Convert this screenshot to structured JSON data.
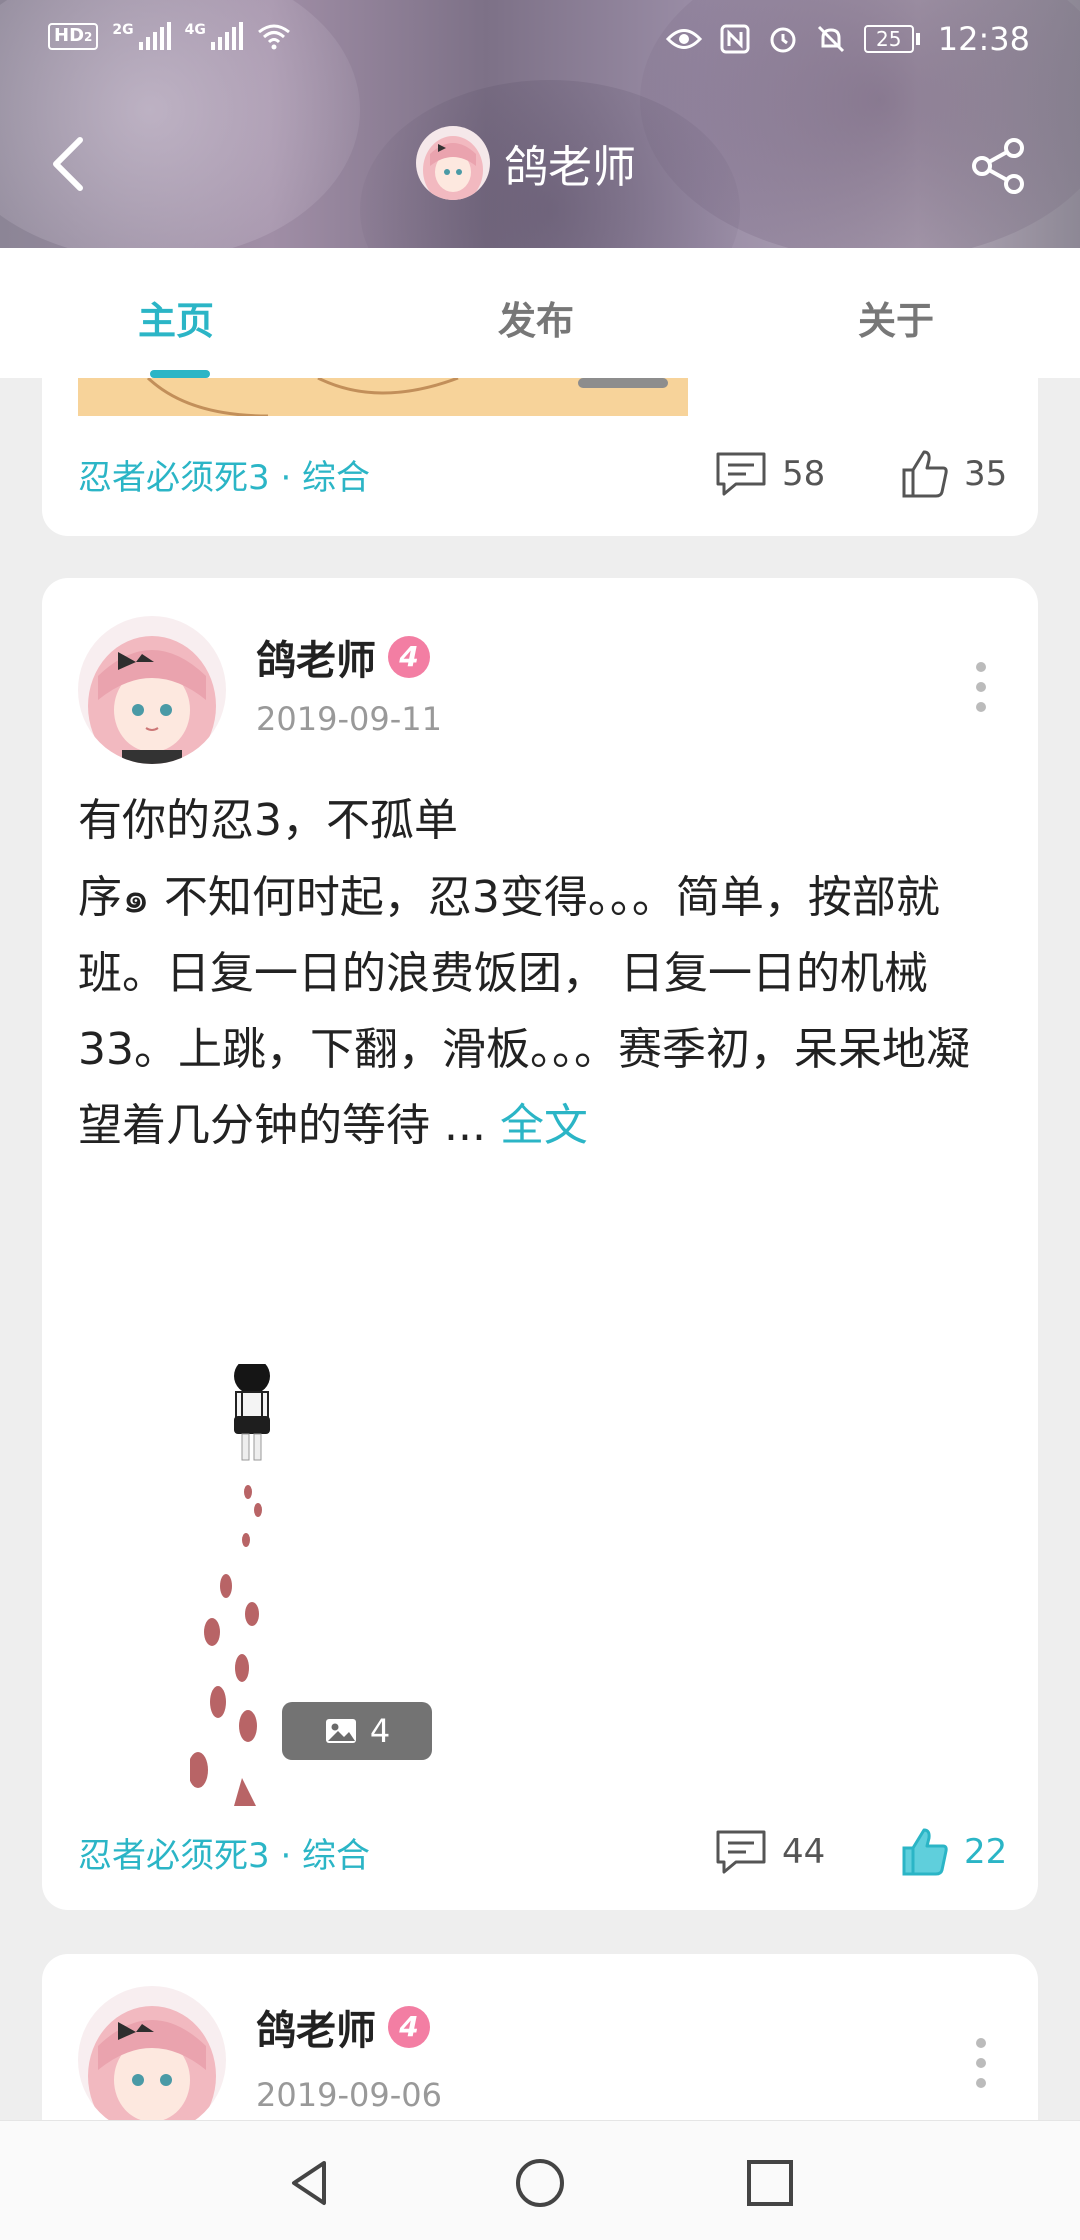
{
  "status_bar": {
    "hd_label": "HD",
    "hd_sub": "2",
    "sig1_label": "2G",
    "sig2_label": "4G",
    "battery": "25",
    "time": "12:38"
  },
  "header": {
    "title": "鸽老师"
  },
  "tabs": [
    {
      "label": "主页",
      "active": true
    },
    {
      "label": "发布",
      "active": false
    },
    {
      "label": "关于",
      "active": false
    }
  ],
  "posts": [
    {
      "topic": "忍者必须死3 · 综合",
      "comments": "58",
      "likes": "35"
    },
    {
      "author": "鸽老师",
      "level": "4",
      "date": "2019-09-11",
      "title": "有你的忍3，不孤单",
      "body": "序๑ 不知何时起，忍3变得。。。简单，按部就班。日复一日的浪费饭团， 日复一日的机械33。上跳，下翻，滑板。。。赛季初，呆呆地凝望着几分钟的等待 ... ",
      "more_label": "全文",
      "image_count": "4",
      "topic": "忍者必须死3 · 综合",
      "comments": "44",
      "likes": "22"
    },
    {
      "author": "鸽老师",
      "level": "4",
      "date": "2019-09-06"
    }
  ],
  "colors": {
    "accent": "#2bb5c6",
    "level_badge": "#f37ea3"
  }
}
